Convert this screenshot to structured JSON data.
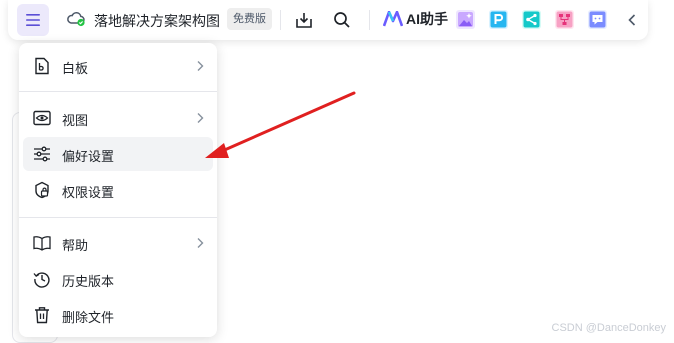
{
  "toolbar": {
    "menu_icon": "hamburger-icon",
    "title": "落地解决方案架构图",
    "badge": "免费版",
    "ai_label": "AI助手",
    "icons": [
      "download-icon",
      "search-icon",
      "image-ai-icon",
      "p-app-icon",
      "share-app-icon",
      "mindmap-app-icon",
      "chat-app-icon",
      "chevron-left-icon"
    ]
  },
  "menu": {
    "items": [
      {
        "label": "白板",
        "icon": "whiteboard-icon",
        "submenu": true
      },
      {
        "label": "视图",
        "icon": "eye-icon",
        "submenu": true
      },
      {
        "label": "偏好设置",
        "icon": "sliders-icon",
        "submenu": false,
        "highlighted": true
      },
      {
        "label": "权限设置",
        "icon": "lock-icon",
        "submenu": false
      },
      {
        "label": "帮助",
        "icon": "book-icon",
        "submenu": true
      },
      {
        "label": "历史版本",
        "icon": "history-icon",
        "submenu": false
      },
      {
        "label": "删除文件",
        "icon": "trash-icon",
        "submenu": false
      }
    ]
  },
  "annotation": {
    "color": "#e02020"
  },
  "colors": {
    "accent": "#7b61ff",
    "menu_btn_bg": "#ece9fb"
  },
  "watermark": "CSDN @DanceDonkey"
}
